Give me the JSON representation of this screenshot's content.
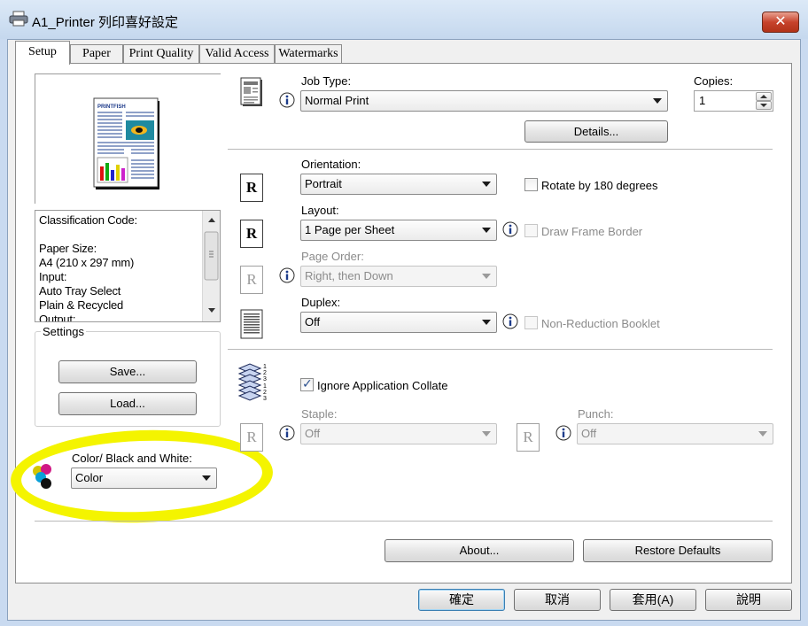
{
  "window": {
    "title": "A1_Printer 列印喜好設定",
    "close_label": "✕"
  },
  "tabs": [
    {
      "label": "Setup",
      "active": true
    },
    {
      "label": "Paper",
      "active": false
    },
    {
      "label": "Print Quality",
      "active": false
    },
    {
      "label": "Valid Access",
      "active": false
    },
    {
      "label": "Watermarks",
      "active": false
    }
  ],
  "preview": {
    "brand": "PRINTFISH"
  },
  "info": {
    "lines": [
      "Classification Code:",
      "",
      "Paper Size:",
      " A4 (210 x 297 mm)",
      "Input:",
      " Auto Tray Select",
      " Plain & Recycled",
      "Output:"
    ]
  },
  "settings": {
    "group_label": "Settings",
    "save_label": "Save...",
    "load_label": "Load..."
  },
  "color_mode": {
    "label": "Color/ Black and White:",
    "value": "Color"
  },
  "job_type": {
    "label": "Job Type:",
    "value": "Normal Print",
    "details_label": "Details..."
  },
  "copies": {
    "label": "Copies:",
    "value": "1"
  },
  "orientation": {
    "label": "Orientation:",
    "value": "Portrait",
    "rotate_label": "Rotate by 180 degrees",
    "rotate_checked": false
  },
  "layout": {
    "label": "Layout:",
    "value": "1 Page per Sheet",
    "frame_label": "Draw Frame Border",
    "frame_checked": false
  },
  "page_order": {
    "label": "Page Order:",
    "value": "Right, then Down"
  },
  "duplex": {
    "label": "Duplex:",
    "value": "Off",
    "booklet_label": "Non-Reduction Booklet",
    "booklet_checked": false
  },
  "collate": {
    "label": "Ignore Application Collate",
    "checked": true
  },
  "staple": {
    "label": "Staple:",
    "value": "Off"
  },
  "punch": {
    "label": "Punch:",
    "value": "Off"
  },
  "panel_buttons": {
    "about_label": "About...",
    "restore_label": "Restore Defaults"
  },
  "dialog_buttons": {
    "ok_label": "確定",
    "cancel_label": "取消",
    "apply_label": "套用(A)",
    "help_label": "說明"
  },
  "icon_glyphs": {
    "orientation": "R",
    "layout": "R",
    "page_order": "R",
    "staple": "R",
    "punch": "R"
  },
  "colors": {
    "highlight": "#f4f400",
    "check_mark": "#2a4f8e",
    "close_button": "#c7432c"
  }
}
